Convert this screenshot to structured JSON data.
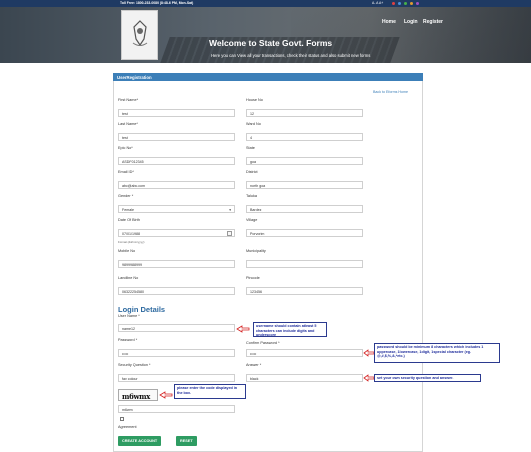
{
  "topbar": {
    "toll_free": "Toll Free: 1800-233-0080 (8:48-6 PM, Mon-Sat)",
    "font_controls": "A- A A+"
  },
  "header": {
    "nav": [
      "Home",
      "Login",
      "Register"
    ],
    "title": "Welcome to State Govt. Forms",
    "subtitle": "Here you can View all your transactions, check their status and also submit new forms"
  },
  "panel": {
    "title": "UserRegistration",
    "back_link": "Back to Eforms Home"
  },
  "fields": {
    "first_name": {
      "label": "First Name*",
      "value": "test"
    },
    "house_no": {
      "label": "House No",
      "value": "12"
    },
    "last_name": {
      "label": "Last Name*",
      "value": "test"
    },
    "ward_no": {
      "label": "Ward No",
      "value": "4"
    },
    "epic_no": {
      "label": "Epic No*",
      "value": "ASDF012345"
    },
    "state": {
      "label": "State",
      "value": "goa"
    },
    "email": {
      "label": "Email ID*",
      "value": "abc@abc.com"
    },
    "district": {
      "label": "District",
      "value": "north goa"
    },
    "gender": {
      "label": "Gender *",
      "value": "Female"
    },
    "taluka": {
      "label": "Taluka",
      "value": "Bardez"
    },
    "dob": {
      "label": "Date Of Birth",
      "value": "07/01/1988",
      "hint": "Format (dd/mm/yyyy)"
    },
    "village": {
      "label": "Village",
      "value": "Porvorim"
    },
    "mobile": {
      "label": "Mobile No",
      "value": "9899988999"
    },
    "municipality": {
      "label": "Municipality",
      "value": ""
    },
    "landline": {
      "label": "Landline No",
      "value": "06322254580"
    },
    "pincode": {
      "label": "Pincode",
      "value": "123456"
    }
  },
  "login": {
    "section_title": "Login Details",
    "username": {
      "label": "User Name *",
      "value": "name12"
    },
    "password": {
      "label": "Password *",
      "value": "•••••"
    },
    "confirm_password": {
      "label": "Confirm Password *",
      "value": "•••••"
    },
    "security_question": {
      "label": "Security Question *",
      "value": "fav colour"
    },
    "answer": {
      "label": "Answer *",
      "value": "black"
    },
    "captcha_text": "m6wmx",
    "captcha_input": "m6wm",
    "agreement_label": "Agreement"
  },
  "notes": {
    "username": "username should contain atleast 5 characters can include digits and underscore",
    "password": "password should be minimum 8 characters which includes 1 uppercase, 1lowercase, 1digit, 1special character (eg. @,#,$,%,&,*etc.)",
    "security": "set your own security question and answer.",
    "captcha": "please enter the code displayed in the box."
  },
  "buttons": {
    "create": "CREATE ACCOUNT",
    "reset": "RESET"
  },
  "colors": {
    "header_blue": "#3c7fb8",
    "title_blue": "#2e6aa0",
    "button_green": "#2e9c62",
    "note_blue": "#1f2d9c",
    "arrow_red": "#d42020"
  }
}
